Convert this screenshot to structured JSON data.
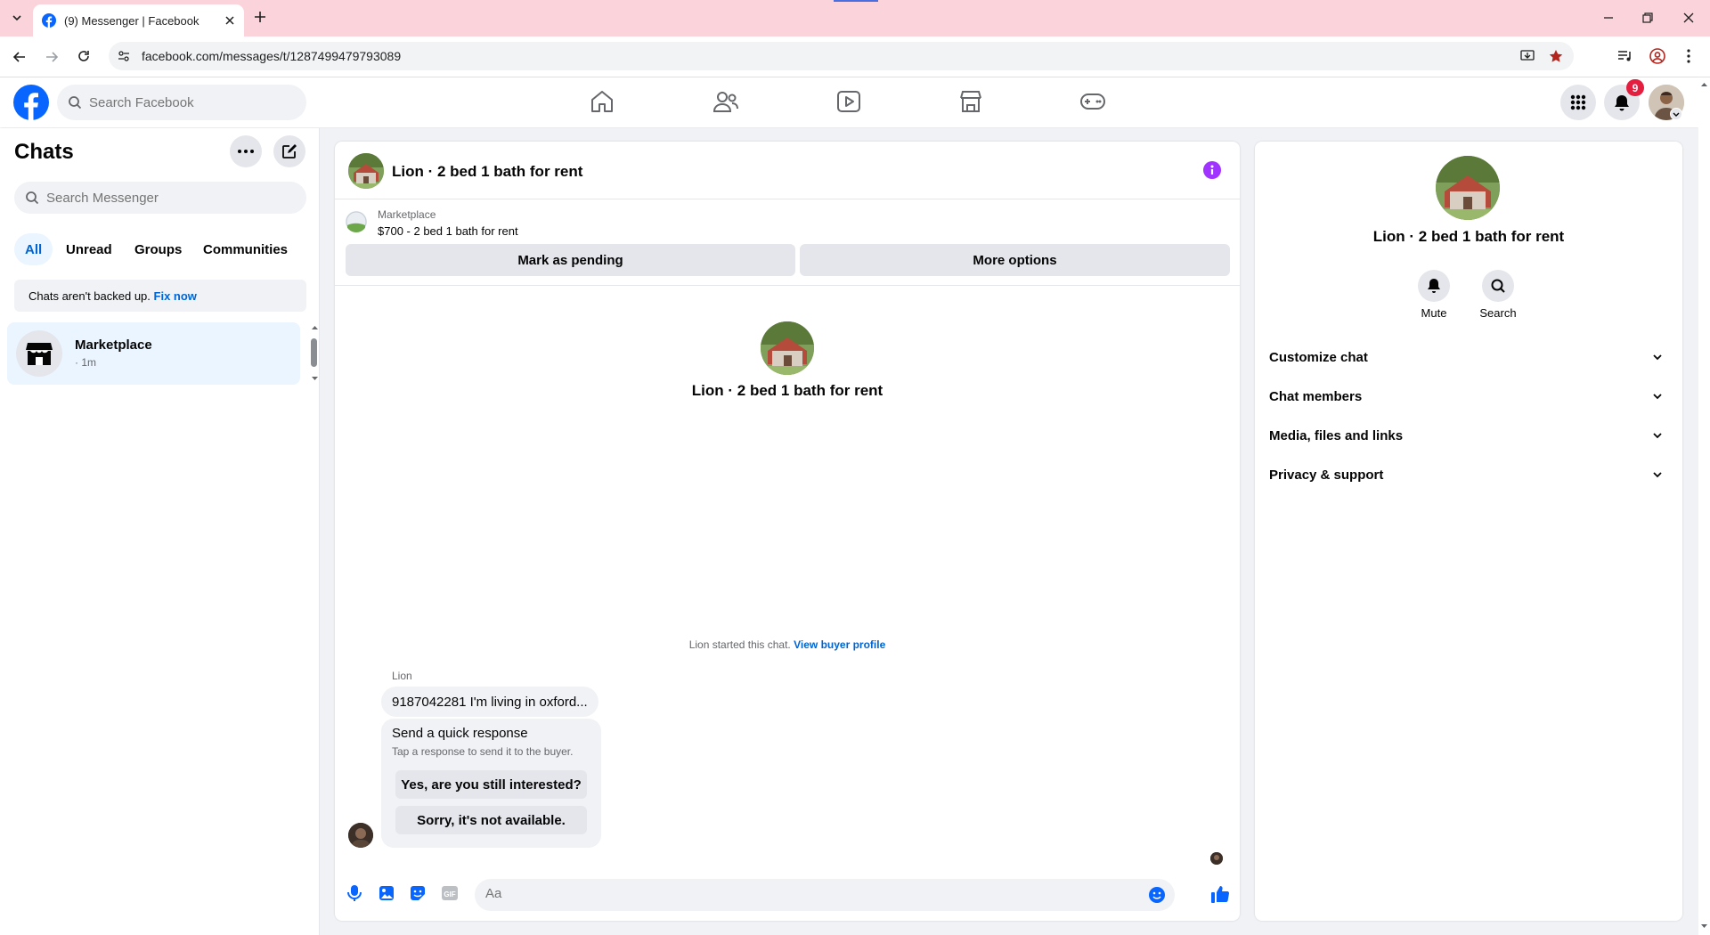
{
  "browser": {
    "tab_title": "(9) Messenger | Facebook",
    "url": "facebook.com/messages/t/1287499479793089"
  },
  "header": {
    "search_placeholder": "Search Facebook",
    "notification_count": "9"
  },
  "chats": {
    "title": "Chats",
    "search_placeholder": "Search Messenger",
    "filters": [
      "All",
      "Unread",
      "Groups",
      "Communities"
    ],
    "backup_text": "Chats aren't backed up.",
    "backup_link": "Fix now",
    "items": [
      {
        "name": "Marketplace",
        "time": "· 1m"
      }
    ]
  },
  "conversation": {
    "title": "Lion · 2 bed 1 bath for rent",
    "listing_source": "Marketplace",
    "listing_title": "$700 - 2 bed 1 bath for rent",
    "mark_pending": "Mark as pending",
    "more_options": "More options",
    "intro_title": "Lion · 2 bed 1 bath for rent",
    "started_text": "Lion started this chat.",
    "buyer_profile_link": "View buyer profile",
    "sender_name": "Lion",
    "message": "9187042281 I'm living in oxford...",
    "quick_response_title": "Send a quick response",
    "quick_response_sub": "Tap a response to send it to the buyer.",
    "quick_responses": [
      "Yes, are you still interested?",
      "Sorry, it's not available."
    ],
    "composer_placeholder": "Aa"
  },
  "details": {
    "title": "Lion · 2 bed 1 bath for rent",
    "mute_label": "Mute",
    "search_label": "Search",
    "sections": [
      "Customize chat",
      "Chat members",
      "Media, files and links",
      "Privacy & support"
    ]
  },
  "colors": {
    "fb_blue": "#0866ff",
    "link_blue": "#0064d1",
    "notif_red": "#e41e3f",
    "info_purple": "#a033ff",
    "tab_bar": "#fbd3da"
  }
}
